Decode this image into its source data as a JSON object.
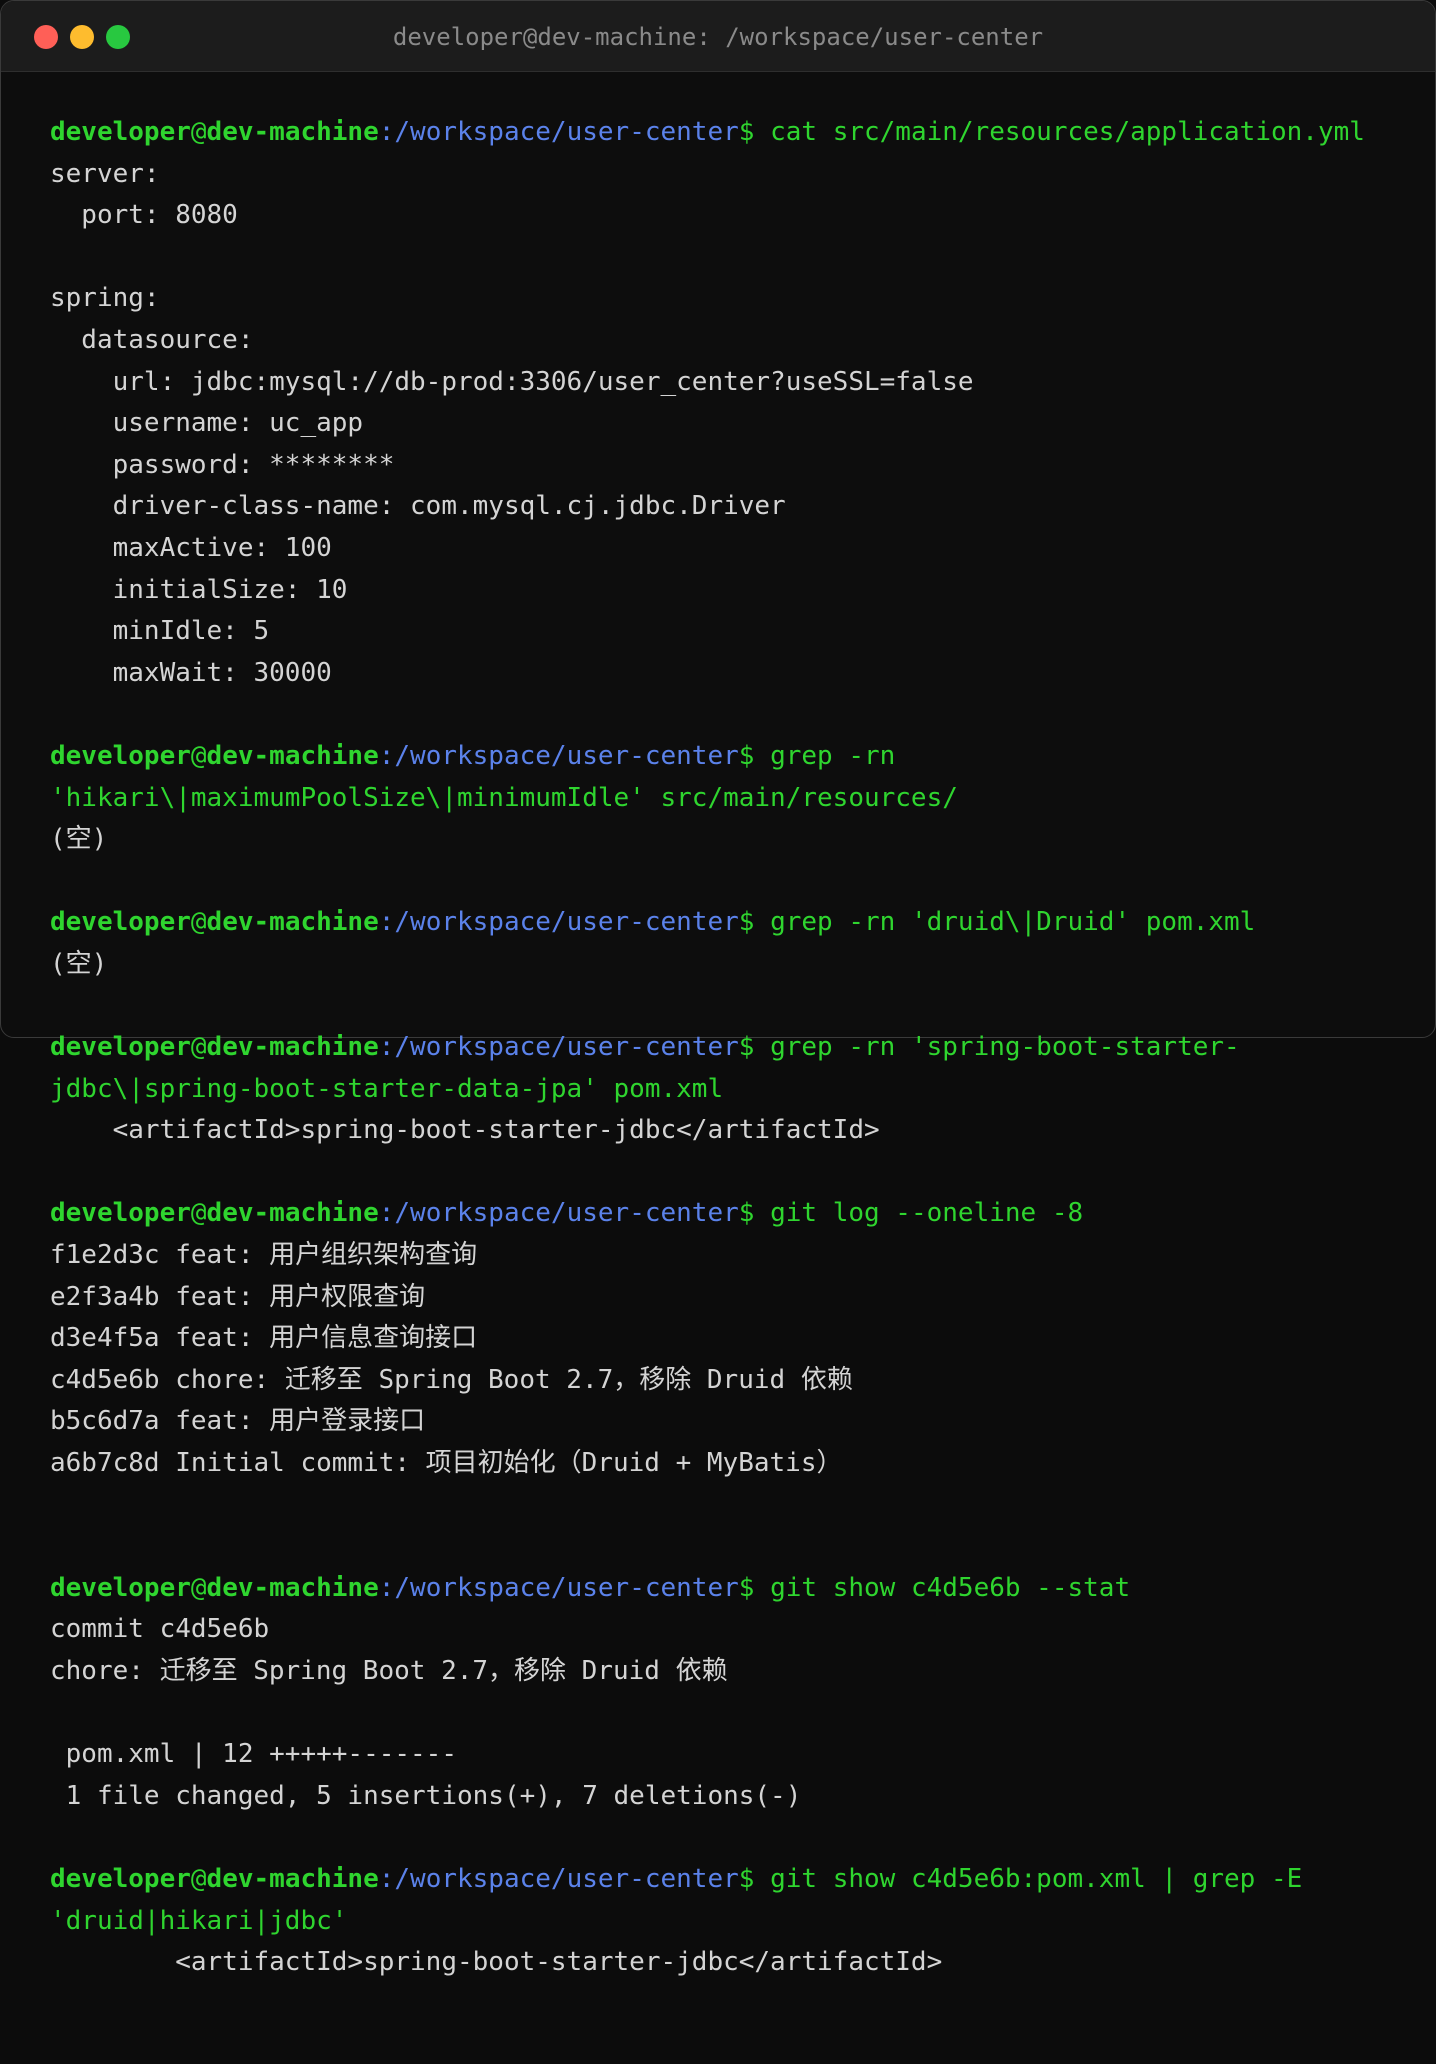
{
  "window": {
    "title": "developer@dev-machine: /workspace/user-center"
  },
  "prompt": {
    "user": "developer",
    "at": "@",
    "host": "dev-machine",
    "path": ":/workspace/user-center",
    "symbol": "$ "
  },
  "lines": [
    {
      "type": "prompt",
      "cmd": "cat src/main/resources/application.yml"
    },
    {
      "type": "out",
      "text": "server:"
    },
    {
      "type": "out",
      "text": "  port: 8080"
    },
    {
      "type": "blank"
    },
    {
      "type": "out",
      "text": "spring:"
    },
    {
      "type": "out",
      "text": "  datasource:"
    },
    {
      "type": "out",
      "text": "    url: jdbc:mysql://db-prod:3306/user_center?useSSL=false"
    },
    {
      "type": "out",
      "text": "    username: uc_app"
    },
    {
      "type": "out",
      "text": "    password: ********"
    },
    {
      "type": "out",
      "text": "    driver-class-name: com.mysql.cj.jdbc.Driver"
    },
    {
      "type": "out",
      "text": "    maxActive: 100"
    },
    {
      "type": "out",
      "text": "    initialSize: 10"
    },
    {
      "type": "out",
      "text": "    minIdle: 5"
    },
    {
      "type": "out",
      "text": "    maxWait: 30000"
    },
    {
      "type": "blank"
    },
    {
      "type": "prompt",
      "cmd": "grep -rn"
    },
    {
      "type": "cmdcont",
      "text": "'hikari\\|maximumPoolSize\\|minimumIdle' src/main/resources/"
    },
    {
      "type": "out",
      "text": "(空)"
    },
    {
      "type": "blank"
    },
    {
      "type": "prompt",
      "cmd": "grep -rn 'druid\\|Druid' pom.xml"
    },
    {
      "type": "out",
      "text": "(空)"
    },
    {
      "type": "blank"
    },
    {
      "type": "prompt",
      "cmd": "grep -rn 'spring-boot-starter-"
    },
    {
      "type": "cmdcont",
      "text": "jdbc\\|spring-boot-starter-data-jpa' pom.xml"
    },
    {
      "type": "out",
      "text": "    <artifactId>spring-boot-starter-jdbc</artifactId>"
    },
    {
      "type": "blank"
    },
    {
      "type": "prompt",
      "cmd": "git log --oneline -8"
    },
    {
      "type": "out",
      "text": "f1e2d3c feat: 用户组织架构查询"
    },
    {
      "type": "out",
      "text": "e2f3a4b feat: 用户权限查询"
    },
    {
      "type": "out",
      "text": "d3e4f5a feat: 用户信息查询接口"
    },
    {
      "type": "out",
      "text": "c4d5e6b chore: 迁移至 Spring Boot 2.7，移除 Druid 依赖"
    },
    {
      "type": "out",
      "text": "b5c6d7a feat: 用户登录接口"
    },
    {
      "type": "out",
      "text": "a6b7c8d Initial commit: 项目初始化（Druid + MyBatis）"
    },
    {
      "type": "blank"
    },
    {
      "type": "blank"
    },
    {
      "type": "prompt",
      "cmd": "git show c4d5e6b --stat"
    },
    {
      "type": "out",
      "text": "commit c4d5e6b"
    },
    {
      "type": "out",
      "text": "chore: 迁移至 Spring Boot 2.7，移除 Druid 依赖"
    },
    {
      "type": "blank"
    },
    {
      "type": "out",
      "text": " pom.xml | 12 +++++-------"
    },
    {
      "type": "out",
      "text": " 1 file changed, 5 insertions(+), 7 deletions(-)"
    },
    {
      "type": "blank"
    },
    {
      "type": "prompt",
      "cmd": "git show c4d5e6b:pom.xml | grep -E"
    },
    {
      "type": "cmdcont",
      "text": "'druid|hikari|jdbc'"
    },
    {
      "type": "out",
      "text": "        <artifactId>spring-boot-starter-jdbc</artifactId>"
    }
  ]
}
